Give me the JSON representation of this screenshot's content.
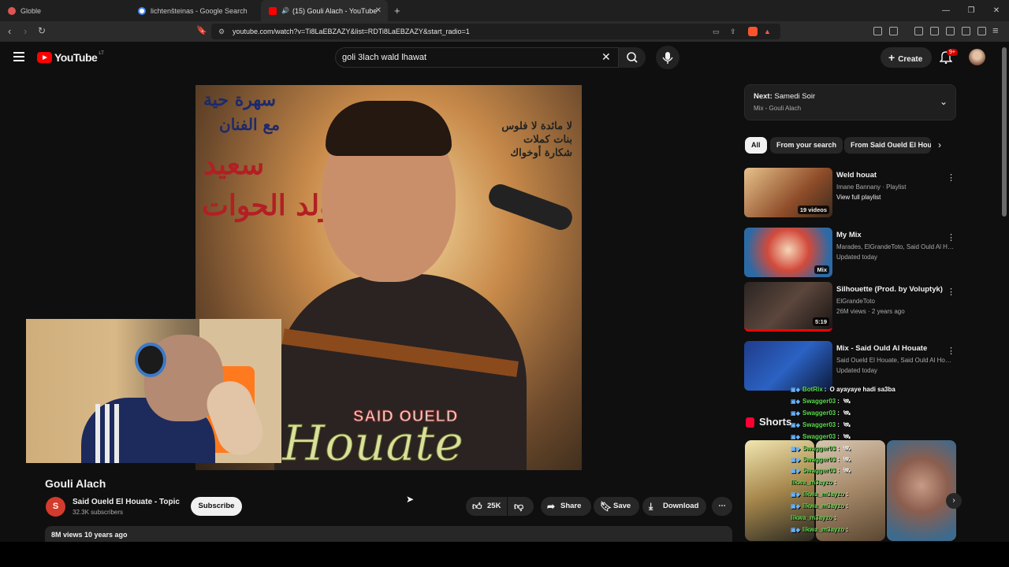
{
  "browser": {
    "tabs": [
      {
        "label": "Globle"
      },
      {
        "label": "lichtenšteinas - Google Search"
      },
      {
        "label": "(15) Gouli Alach - YouTube"
      }
    ],
    "new_tab": "+",
    "url": "youtube.com/watch?v=Ti8LaEBZAZY&list=RDTi8LaEBZAZY&start_radio=1"
  },
  "header": {
    "logo_text": "YouTube",
    "country": "LT",
    "search_value": "goli 3lach wald lhawat",
    "create_label": "Create",
    "notifications": "9+"
  },
  "video": {
    "overlay_text_latin": "SAID OUELD",
    "overlay_text_script": "Houate",
    "arabic_1": "سهرة حية",
    "arabic_2": "مع الفنان",
    "arabic_3": "سعيد",
    "arabic_4": "ولد الحوات",
    "arabic_side": "لا مائدة لا فلوس\nبنات كملات\nشكارة أوخواك"
  },
  "meta": {
    "title": "Gouli Alach",
    "channel_initial": "S",
    "channel_name": "Said Oueld El Houate - Topic",
    "subscribers": "32.3K subscribers",
    "subscribe_label": "Subscribe",
    "likes": "25K",
    "share_label": "Share",
    "save_label": "Save",
    "download_label": "Download",
    "views_date": "8M views  10 years ago"
  },
  "sidebar": {
    "next_label": "Next:",
    "next_title": "Samedi Soir",
    "next_sub": "Mix - Gouli Alach",
    "chips": [
      "All",
      "From your search",
      "From Said Oueld El Houate"
    ],
    "recommendations": [
      {
        "title": "Weld houat",
        "line1": "Imane Bannany · Playlist",
        "line2": "View full playlist",
        "badge": "19 videos"
      },
      {
        "title": "My Mix",
        "line1": "Marades, ElGrandeToto, Said Ould Al Houate...",
        "line2": "Updated today",
        "badge": "Mix"
      },
      {
        "title": "Silhouette (Prod. by Voluptyk)",
        "line1": "ElGrandeToto",
        "line2": "26M views · 2 years ago",
        "badge": "5:19"
      },
      {
        "title": "Mix - Said Ould Al Houate",
        "line1": "Said Oueld El Houate, Said Ould Al Houate...",
        "line2": "Updated today",
        "badge": ""
      }
    ],
    "shorts_label": "Shorts"
  },
  "chat": [
    {
      "user": "BotRix",
      "msg": "O ayayaye hadi sa3ba"
    },
    {
      "user": "Swagger03",
      "msg": ""
    },
    {
      "user": "Swagger03",
      "msg": ""
    },
    {
      "user": "Swagger03",
      "msg": ""
    },
    {
      "user": "Swagger03",
      "msg": ""
    },
    {
      "user": "Swagger03",
      "msg": ""
    },
    {
      "user": "Swagger03",
      "msg": ""
    },
    {
      "user": "Swagger03",
      "msg": ""
    },
    {
      "user": "likwa_m3ayzo",
      "msg": ""
    },
    {
      "user": "likwa_m3ayzo",
      "msg": ""
    },
    {
      "user": "likwa_m3ayzo",
      "msg": ""
    },
    {
      "user": "likwa_m3ayzo",
      "msg": ""
    },
    {
      "user": "likwa_m3ayzo",
      "msg": ""
    }
  ],
  "colors": {
    "accent": "#ff0000",
    "background": "#0f0f0f",
    "chat_user": "#5ddc4e"
  }
}
